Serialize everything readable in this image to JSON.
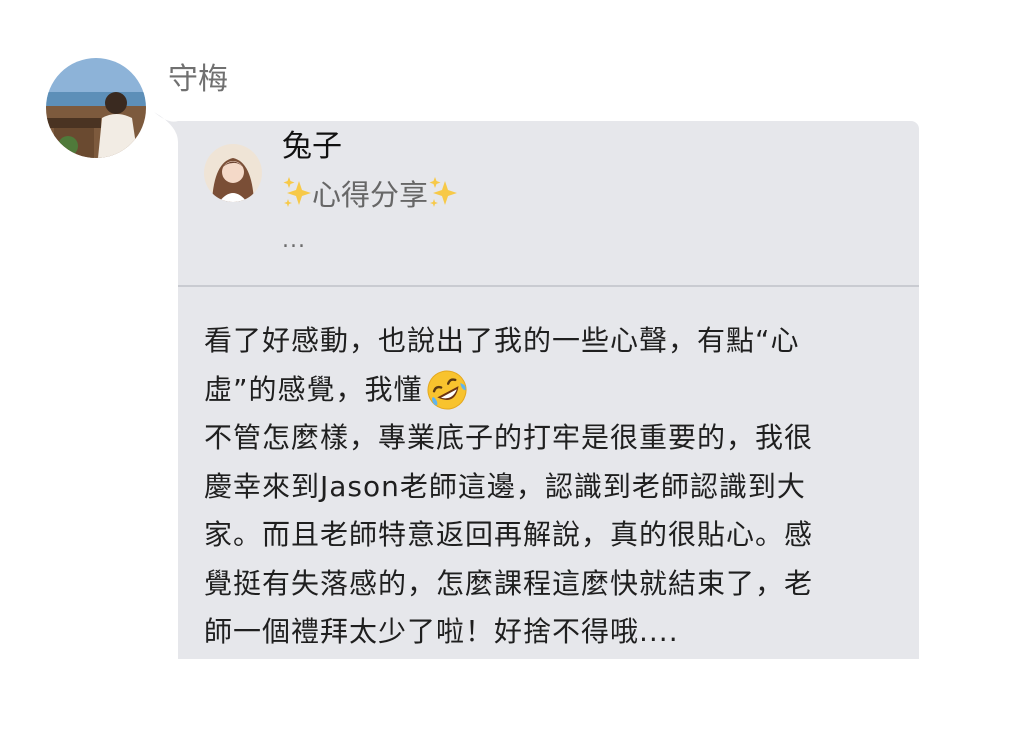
{
  "post": {
    "sender_name": "守梅",
    "quoted": {
      "author": "兔子",
      "title": "心得分享",
      "title_icon": "sparkles-icon",
      "ellipsis": "..."
    },
    "message_lines": [
      "看了好感動，也說出了我的一些心聲，有點“心",
      "虛”的感覺，我懂",
      "不管怎麼樣，專業底子的打牢是很重要的，我很",
      "慶幸來到Jason老師這邊，認識到老師認識到大",
      "家。而且老師特意返回再解說，真的很貼心。感",
      "覺挺有失落感的，怎麼課程這麼快就結束了，老",
      "師一個禮拜太少了啦！好捨不得哦...."
    ],
    "emoji": "rolling-on-floor-laughing-icon"
  },
  "colors": {
    "bubble_background": "#e6e7eb",
    "divider": "#c9cbd1",
    "sender_name": "#707070",
    "sparkle": "#f7c948"
  }
}
